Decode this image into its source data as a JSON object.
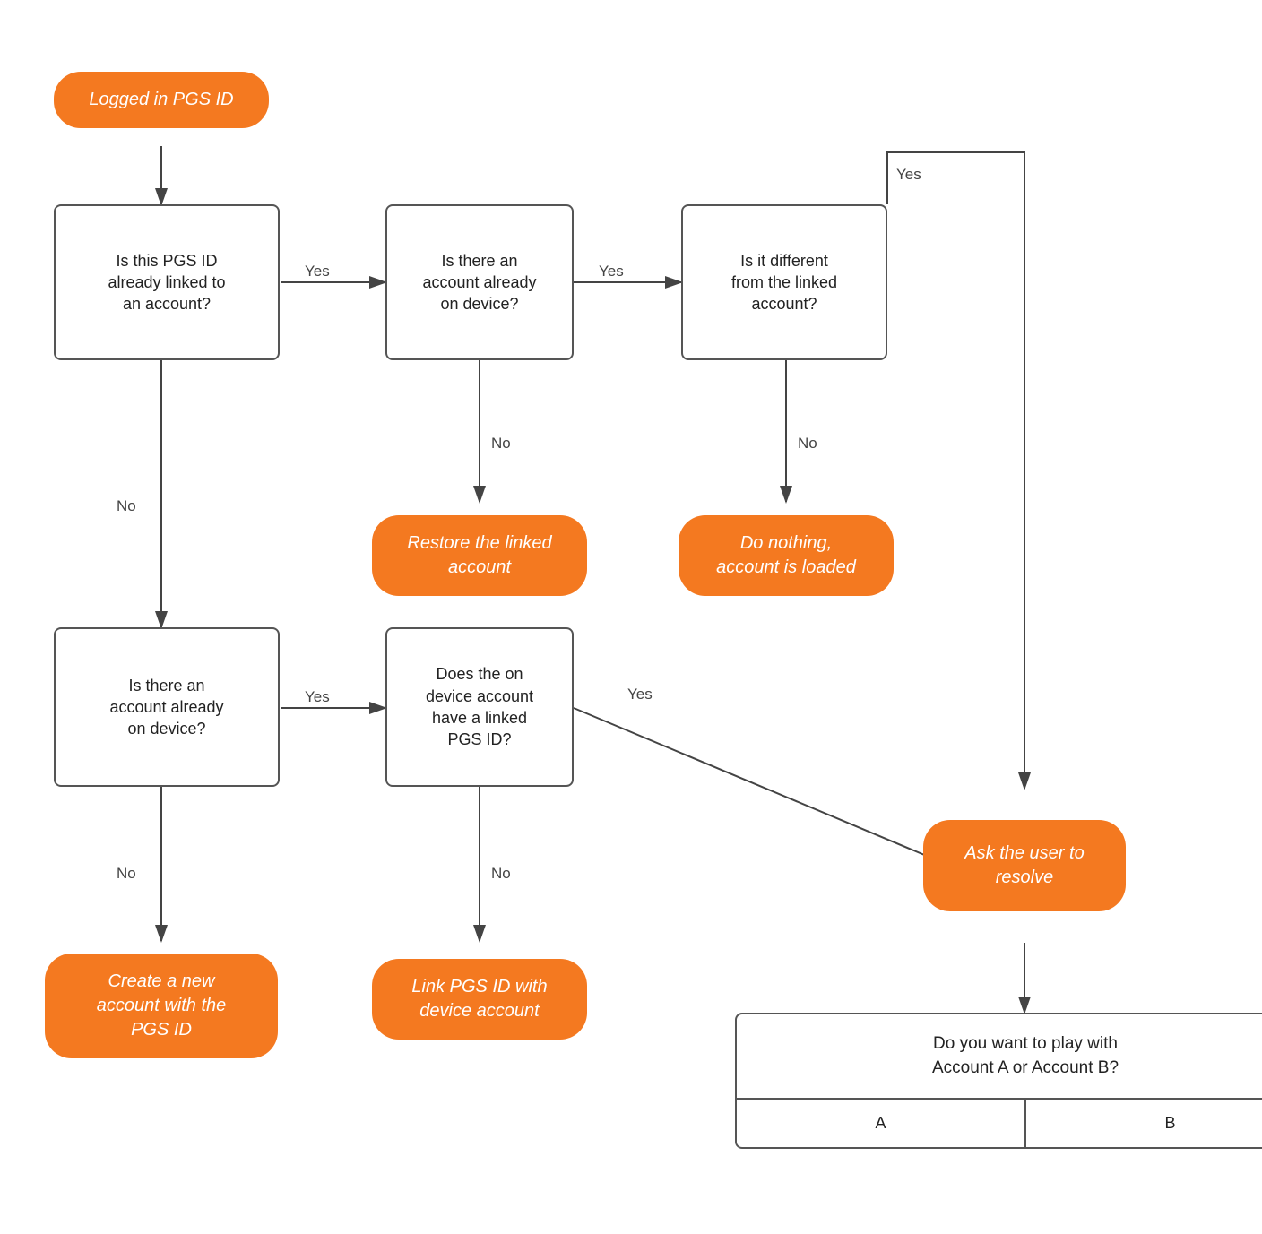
{
  "nodes": {
    "start": {
      "label": "Logged in PGS ID"
    },
    "q1": {
      "label": "Is this PGS ID\nalready linked to\nan account?"
    },
    "q2": {
      "label": "Is there an\naccount already\non device?"
    },
    "q3": {
      "label": "Is it different\nfrom the linked\naccount?"
    },
    "action_restore": {
      "label": "Restore the linked\naccount"
    },
    "action_donothing": {
      "label": "Do nothing,\naccount is loaded"
    },
    "q4": {
      "label": "Is there an\naccount already\non device?"
    },
    "q5": {
      "label": "Does the on\ndevice account\nhave a linked\nPGS ID?"
    },
    "action_ask": {
      "label": "Ask the user to\nresolve"
    },
    "action_create": {
      "label": "Create a new\naccount with the\nPGS  ID"
    },
    "action_link": {
      "label": "Link PGS ID with\ndevice account"
    },
    "dialog_text": {
      "label": "Do you want to play with\nAccount A or Account B?"
    },
    "dialog_a": {
      "label": "A"
    },
    "dialog_b": {
      "label": "B"
    }
  },
  "labels": {
    "yes": "Yes",
    "no": "No"
  },
  "colors": {
    "orange": "#f47920",
    "border": "#555",
    "text": "#222",
    "arrow": "#444"
  }
}
